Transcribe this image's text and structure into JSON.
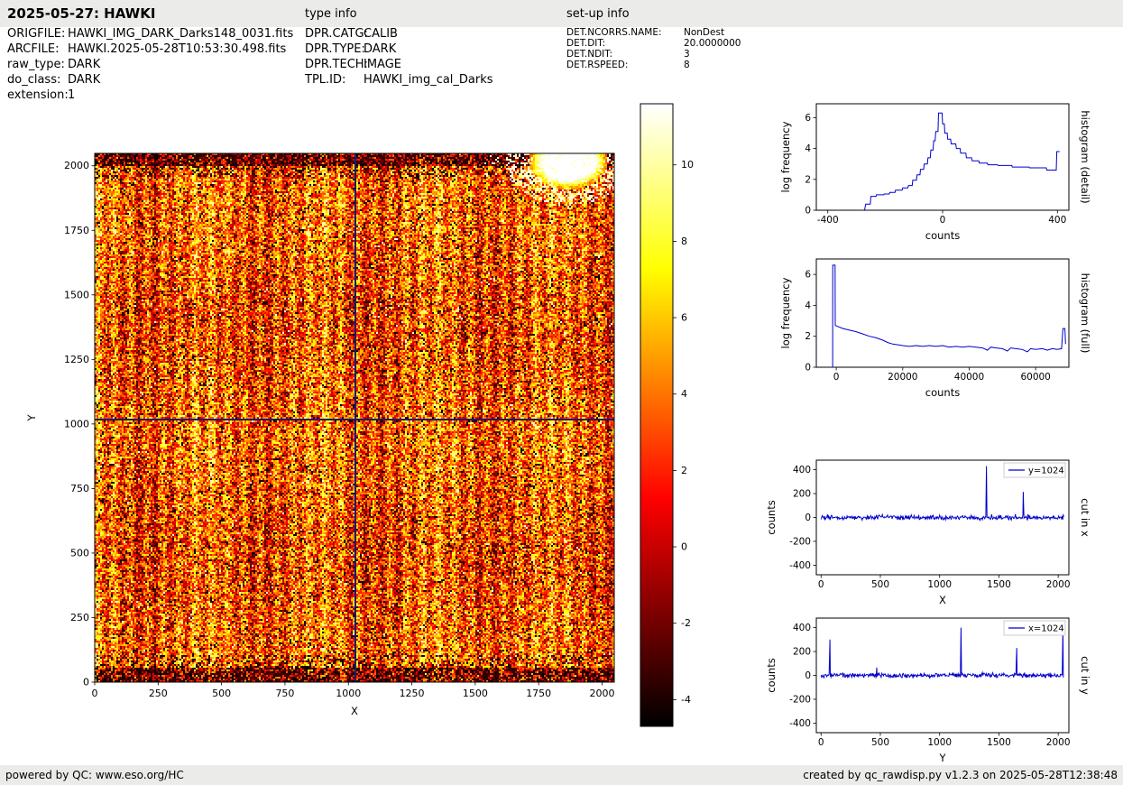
{
  "header": {
    "title": "2025-05-27: HAWKI",
    "type_info_label": "type info",
    "setup_info_label": "set-up info"
  },
  "file_info": {
    "rows": [
      {
        "label": "ORIGFILE:",
        "value": "HAWKI_IMG_DARK_Darks148_0031.fits"
      },
      {
        "label": "ARCFILE:",
        "value": "HAWKI.2025-05-28T10:53:30.498.fits"
      },
      {
        "label": "raw_type:",
        "value": "DARK"
      },
      {
        "label": "do_class:",
        "value": "DARK"
      },
      {
        "label": "extension:",
        "value": "1"
      }
    ]
  },
  "type_info": {
    "rows": [
      {
        "label": "DPR.CATG:",
        "value": "CALIB"
      },
      {
        "label": "DPR.TYPE:",
        "value": "DARK"
      },
      {
        "label": "DPR.TECH:",
        "value": "IMAGE"
      },
      {
        "label": "TPL.ID:",
        "value": "HAWKI_img_cal_Darks"
      }
    ]
  },
  "setup_info": {
    "rows": [
      {
        "label": "DET.NCORRS.NAME:",
        "value": "NonDest"
      },
      {
        "label": "DET.DIT:",
        "value": "20.0000000"
      },
      {
        "label": "DET.NDIT:",
        "value": "3"
      },
      {
        "label": "DET.RSPEED:",
        "value": "8"
      }
    ]
  },
  "footer": {
    "left": "powered by QC: www.eso.org/HC",
    "right": "created by qc_rawdisp.py v1.2.3 on 2025-05-28T12:38:48"
  },
  "colors": {
    "line": "#0000cc",
    "crosshair": "#1a1a6e",
    "header_bg": "#ebebe9",
    "legend_border": "#cccccc"
  },
  "chart_data": [
    {
      "id": "main_image",
      "type": "heatmap",
      "xlabel": "X",
      "ylabel": "Y",
      "xlim": [
        0,
        2048
      ],
      "ylim": [
        0,
        2048
      ],
      "xticks": [
        0,
        250,
        500,
        750,
        1000,
        1250,
        1500,
        1750,
        2000
      ],
      "yticks": [
        0,
        250,
        500,
        750,
        1000,
        1250,
        1500,
        1750,
        2000
      ],
      "colormap": "hot",
      "crosshair": {
        "x": 1024,
        "y": 1024
      },
      "features": "noisy raw dark frame; black speckled bands along top and bottom edges; saturated white blob near top-right corner; vertical column striping"
    },
    {
      "id": "colorbar",
      "type": "colorbar",
      "colormap": "hot",
      "vmin": -4.7,
      "vmax": 11.6,
      "ticks": [
        10,
        8,
        6,
        4,
        2,
        0,
        -2,
        -4
      ]
    },
    {
      "id": "histogram_detail",
      "type": "line",
      "xlabel": "counts",
      "ylabel": "log frequency",
      "right_label": "histogram (detail)",
      "xlim": [
        -440,
        440
      ],
      "ylim": [
        0,
        6.9
      ],
      "xticks": [
        -400,
        0,
        400
      ],
      "yticks": [
        0,
        2,
        4,
        6
      ],
      "points": [
        [
          -272,
          0
        ],
        [
          -268,
          0.4
        ],
        [
          -252,
          0.4
        ],
        [
          -250,
          0.9
        ],
        [
          -232,
          0.9
        ],
        [
          -230,
          1.0
        ],
        [
          -205,
          1.0
        ],
        [
          -203,
          1.05
        ],
        [
          -186,
          1.05
        ],
        [
          -184,
          1.15
        ],
        [
          -166,
          1.15
        ],
        [
          -164,
          1.3
        ],
        [
          -141,
          1.3
        ],
        [
          -139,
          1.45
        ],
        [
          -121,
          1.45
        ],
        [
          -119,
          1.6
        ],
        [
          -106,
          1.6
        ],
        [
          -104,
          1.95
        ],
        [
          -91,
          1.95
        ],
        [
          -89,
          2.3
        ],
        [
          -79,
          2.3
        ],
        [
          -77,
          2.65
        ],
        [
          -66,
          2.65
        ],
        [
          -64,
          3.0
        ],
        [
          -53,
          3.0
        ],
        [
          -51,
          3.4
        ],
        [
          -43,
          3.4
        ],
        [
          -41,
          3.9
        ],
        [
          -33,
          3.9
        ],
        [
          -31,
          4.5
        ],
        [
          -26,
          4.5
        ],
        [
          -24,
          5.1
        ],
        [
          -16,
          5.1
        ],
        [
          -14,
          6.3
        ],
        [
          -2,
          6.3
        ],
        [
          0,
          5.6
        ],
        [
          6,
          5.6
        ],
        [
          8,
          5.0
        ],
        [
          16,
          5.0
        ],
        [
          18,
          4.6
        ],
        [
          28,
          4.6
        ],
        [
          30,
          4.3
        ],
        [
          46,
          4.3
        ],
        [
          48,
          4.0
        ],
        [
          61,
          4.0
        ],
        [
          63,
          3.7
        ],
        [
          81,
          3.7
        ],
        [
          83,
          3.4
        ],
        [
          101,
          3.4
        ],
        [
          103,
          3.2
        ],
        [
          126,
          3.2
        ],
        [
          128,
          3.05
        ],
        [
          156,
          3.05
        ],
        [
          158,
          2.95
        ],
        [
          191,
          2.95
        ],
        [
          193,
          2.9
        ],
        [
          241,
          2.9
        ],
        [
          243,
          2.8
        ],
        [
          301,
          2.8
        ],
        [
          303,
          2.75
        ],
        [
          361,
          2.75
        ],
        [
          363,
          2.6
        ],
        [
          396,
          2.6
        ],
        [
          398,
          3.8
        ],
        [
          408,
          3.8
        ]
      ]
    },
    {
      "id": "histogram_full",
      "type": "line",
      "xlabel": "counts",
      "ylabel": "log frequency",
      "right_label": "histogram (full)",
      "xlim": [
        -6000,
        70000
      ],
      "ylim": [
        0,
        7.0
      ],
      "xticks": [
        0,
        20000,
        40000,
        60000
      ],
      "yticks": [
        0,
        2,
        4,
        6
      ],
      "points": [
        [
          -1800,
          0
        ],
        [
          -1100,
          0
        ],
        [
          -1050,
          6.6
        ],
        [
          -350,
          6.6
        ],
        [
          -300,
          2.7
        ],
        [
          2000,
          2.5
        ],
        [
          4000,
          2.4
        ],
        [
          6000,
          2.3
        ],
        [
          8000,
          2.15
        ],
        [
          10000,
          2.0
        ],
        [
          12000,
          1.9
        ],
        [
          14000,
          1.75
        ],
        [
          15500,
          1.6
        ],
        [
          17000,
          1.5
        ],
        [
          18500,
          1.45
        ],
        [
          20000,
          1.4
        ],
        [
          22000,
          1.35
        ],
        [
          24000,
          1.4
        ],
        [
          26000,
          1.35
        ],
        [
          28000,
          1.4
        ],
        [
          30000,
          1.35
        ],
        [
          32000,
          1.4
        ],
        [
          34000,
          1.3
        ],
        [
          36000,
          1.35
        ],
        [
          38000,
          1.3
        ],
        [
          40000,
          1.35
        ],
        [
          42000,
          1.3
        ],
        [
          44000,
          1.25
        ],
        [
          45500,
          1.1
        ],
        [
          46500,
          1.3
        ],
        [
          48000,
          1.25
        ],
        [
          50000,
          1.2
        ],
        [
          51500,
          1.05
        ],
        [
          52500,
          1.25
        ],
        [
          54000,
          1.2
        ],
        [
          56000,
          1.15
        ],
        [
          57500,
          1.0
        ],
        [
          58500,
          1.2
        ],
        [
          60000,
          1.15
        ],
        [
          62000,
          1.2
        ],
        [
          63500,
          1.1
        ],
        [
          65000,
          1.2
        ],
        [
          66500,
          1.15
        ],
        [
          67800,
          1.2
        ],
        [
          68200,
          2.5
        ],
        [
          68800,
          2.5
        ],
        [
          69000,
          1.5
        ]
      ]
    },
    {
      "id": "cut_x",
      "type": "line",
      "xlabel": "X",
      "ylabel": "counts",
      "right_label": "cut in x",
      "legend": "y=1024",
      "xlim": [
        -40,
        2090
      ],
      "ylim": [
        -480,
        480
      ],
      "xticks": [
        0,
        500,
        1000,
        1500,
        2000
      ],
      "yticks": [
        -400,
        -200,
        0,
        200,
        400
      ],
      "baseline": 0,
      "noise_amp": 16,
      "spikes": [
        [
          1395,
          430
        ],
        [
          1705,
          215
        ]
      ]
    },
    {
      "id": "cut_y",
      "type": "line",
      "xlabel": "Y",
      "ylabel": "counts",
      "right_label": "cut in y",
      "legend": "x=1024",
      "xlim": [
        -40,
        2090
      ],
      "ylim": [
        -480,
        480
      ],
      "xticks": [
        0,
        500,
        1000,
        1500,
        2000
      ],
      "yticks": [
        -400,
        -200,
        0,
        200,
        400
      ],
      "baseline": 0,
      "noise_amp": 16,
      "spikes": [
        [
          75,
          300
        ],
        [
          470,
          65
        ],
        [
          1180,
          400
        ],
        [
          1650,
          230
        ],
        [
          2040,
          390
        ]
      ]
    }
  ]
}
